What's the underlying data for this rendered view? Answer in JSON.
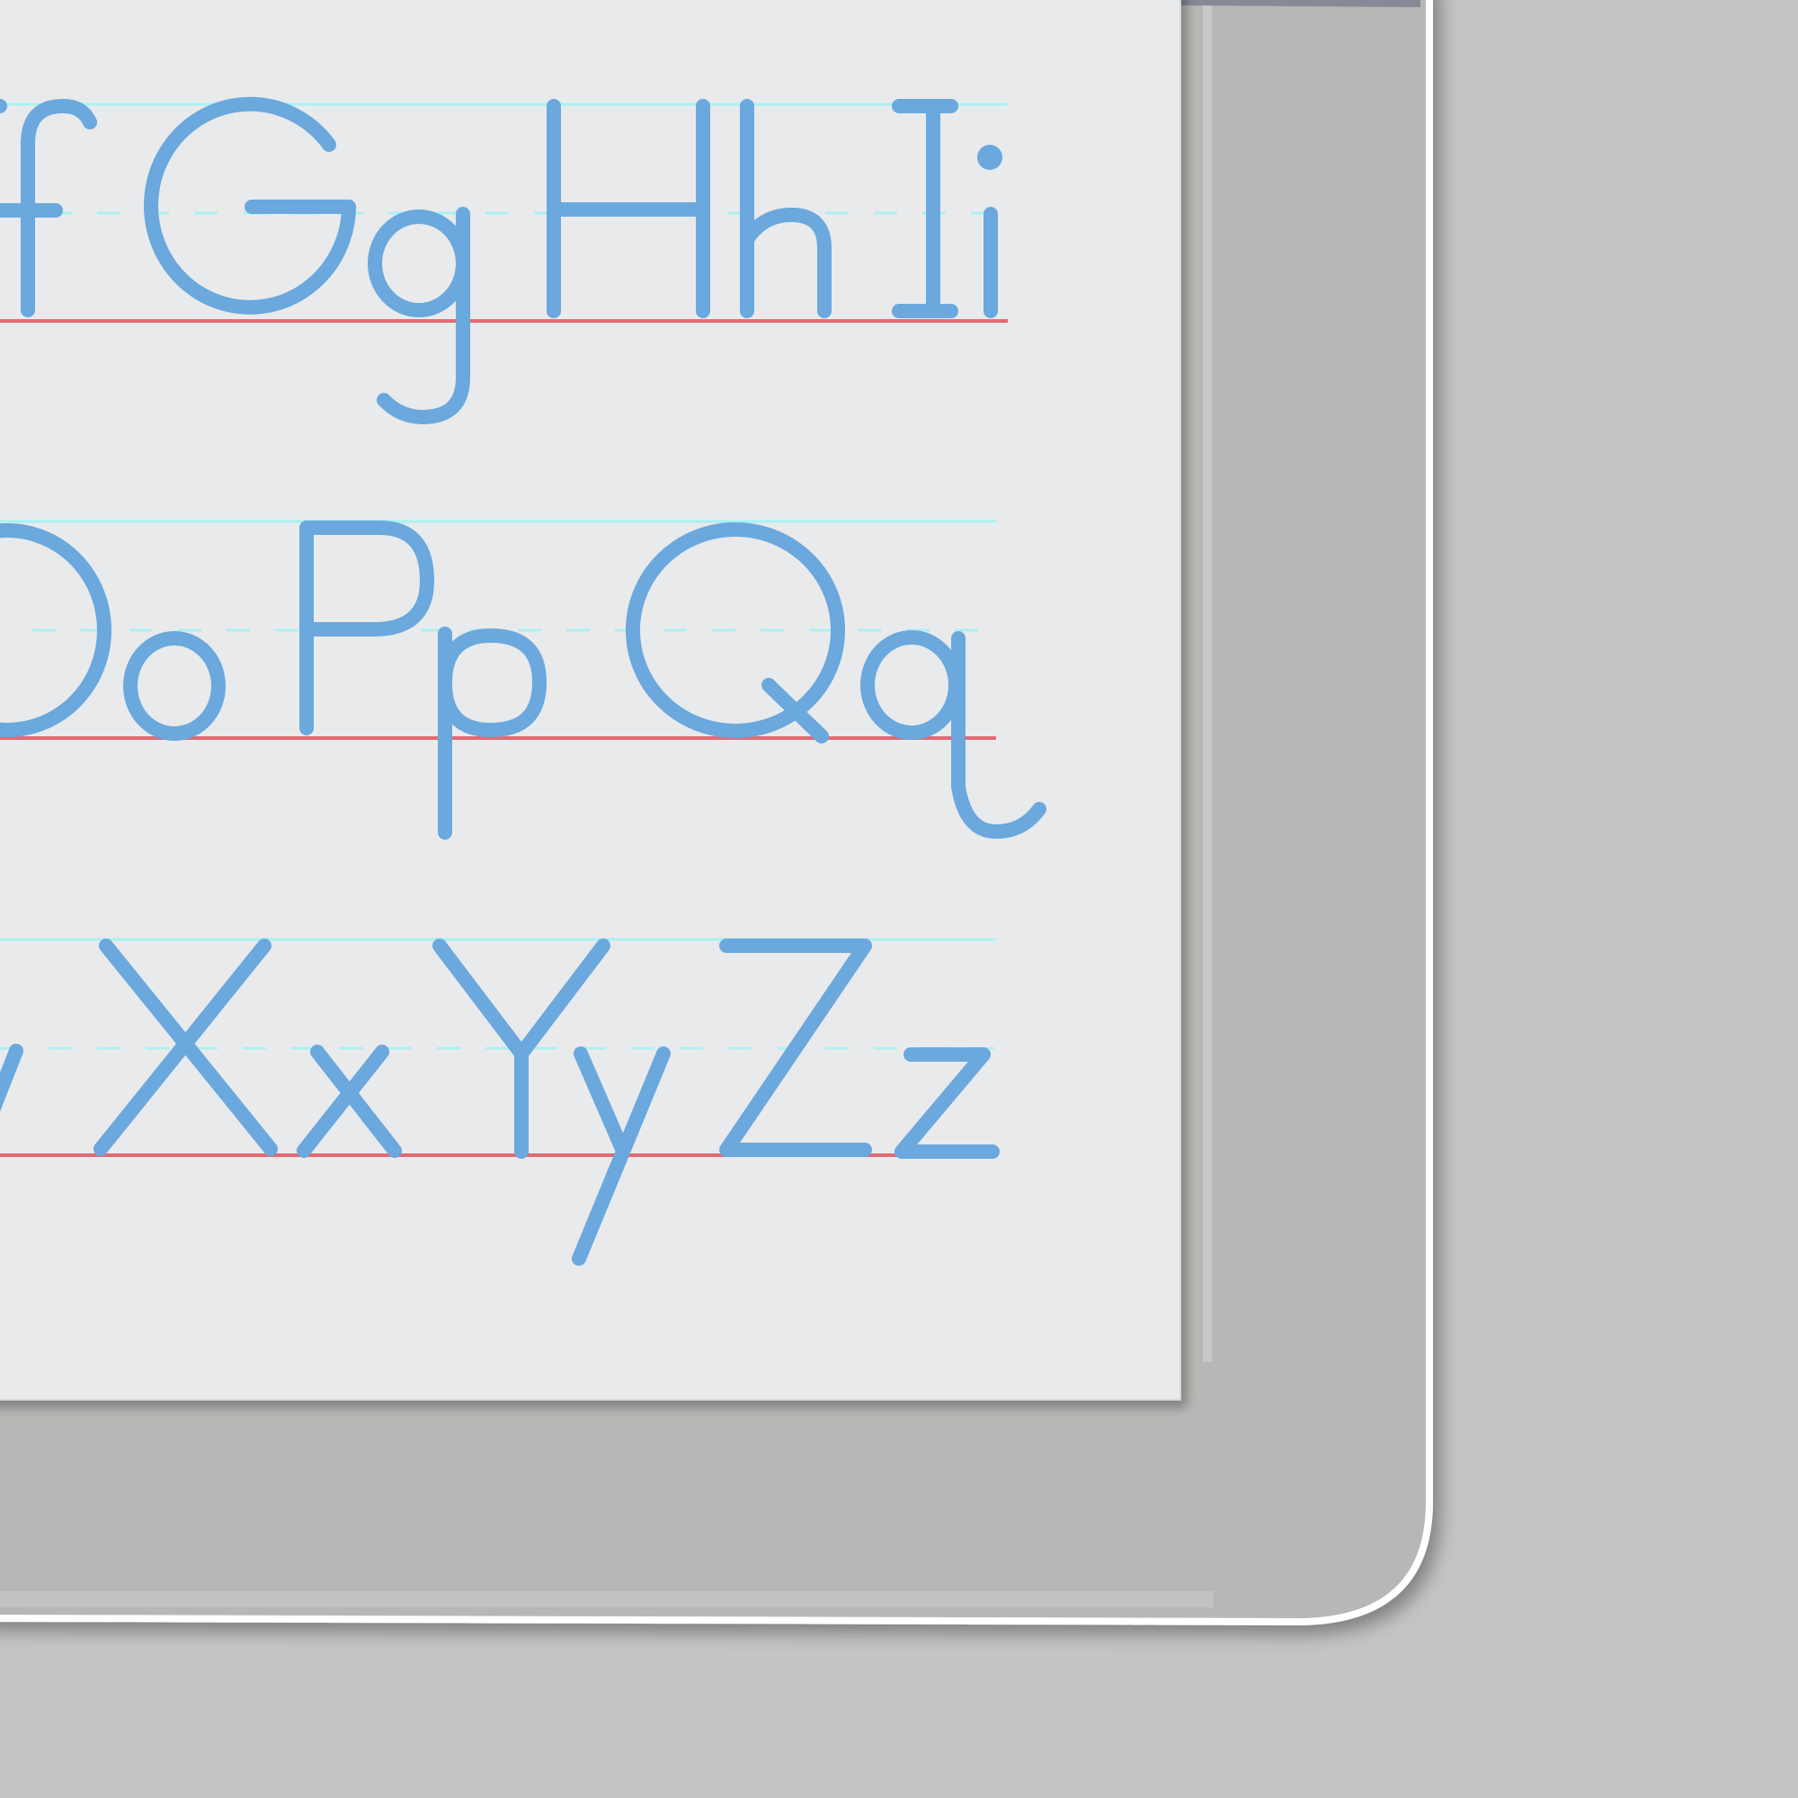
{
  "colors": {
    "background": "#c4c4c4",
    "device_body": "#b7b8b5",
    "device_edge": "#ffffff",
    "screen": "#e9eaec",
    "letter_stroke": "#6aa8dd",
    "headline": "#a8f2f2",
    "midline": "#aef0f2",
    "baseline": "#e26a74"
  },
  "worksheet": {
    "rows": [
      {
        "letters": [
          "f",
          "G",
          "g",
          "H",
          "h",
          "I",
          "i"
        ]
      },
      {
        "letters": [
          "O",
          "o",
          "P",
          "p",
          "Q",
          "q"
        ]
      },
      {
        "letters": [
          "v",
          "X",
          "x",
          "Y",
          "y",
          "Z",
          "z"
        ]
      }
    ]
  }
}
